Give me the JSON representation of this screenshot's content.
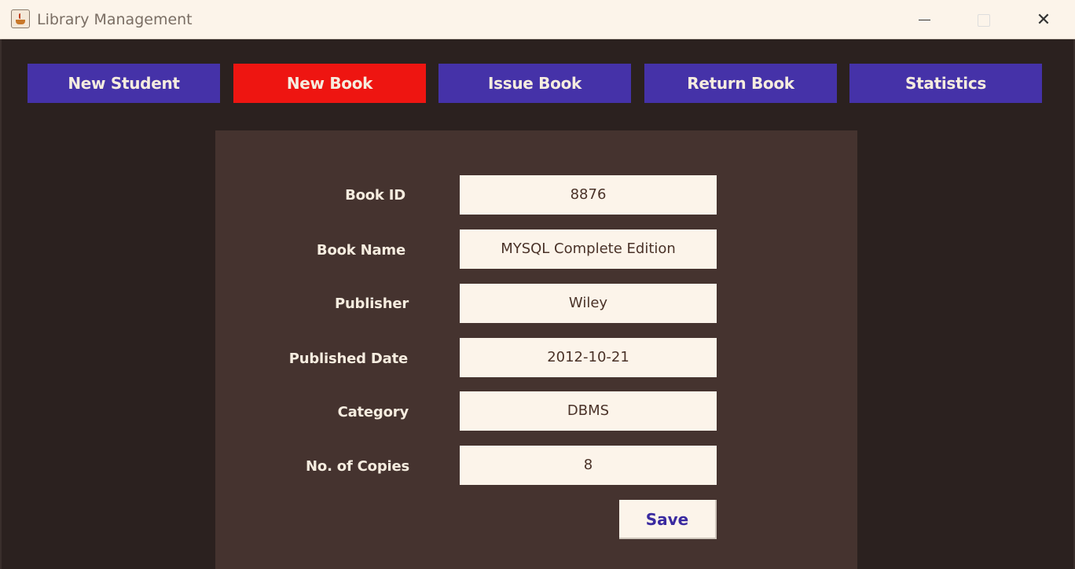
{
  "window": {
    "title": "Library Management",
    "minimize_label": "",
    "maximize_label": "",
    "close_label": "✕"
  },
  "nav": {
    "items": [
      {
        "label": "New Student"
      },
      {
        "label": "New Book"
      },
      {
        "label": "Issue Book"
      },
      {
        "label": "Return Book"
      },
      {
        "label": "Statistics"
      }
    ],
    "active_item": "New Book"
  },
  "form": {
    "fields": [
      {
        "label": "Book ID",
        "value": "8876"
      },
      {
        "label": "Book Name",
        "value": "MYSQL Complete Edition"
      },
      {
        "label": "Publisher",
        "value": "Wiley"
      },
      {
        "label": "Published Date",
        "value": "2012-10-21"
      },
      {
        "label": "Category",
        "value": "DBMS"
      },
      {
        "label": "No. of Copies",
        "value": "8"
      }
    ],
    "save_label": "Save"
  },
  "colors": {
    "nav_button": "#4532a8",
    "nav_active": "#ee1511",
    "background": "#2b211f",
    "panel": "#45332f",
    "input_bg": "#fcf4ea",
    "save_text": "#3a2aa0"
  }
}
